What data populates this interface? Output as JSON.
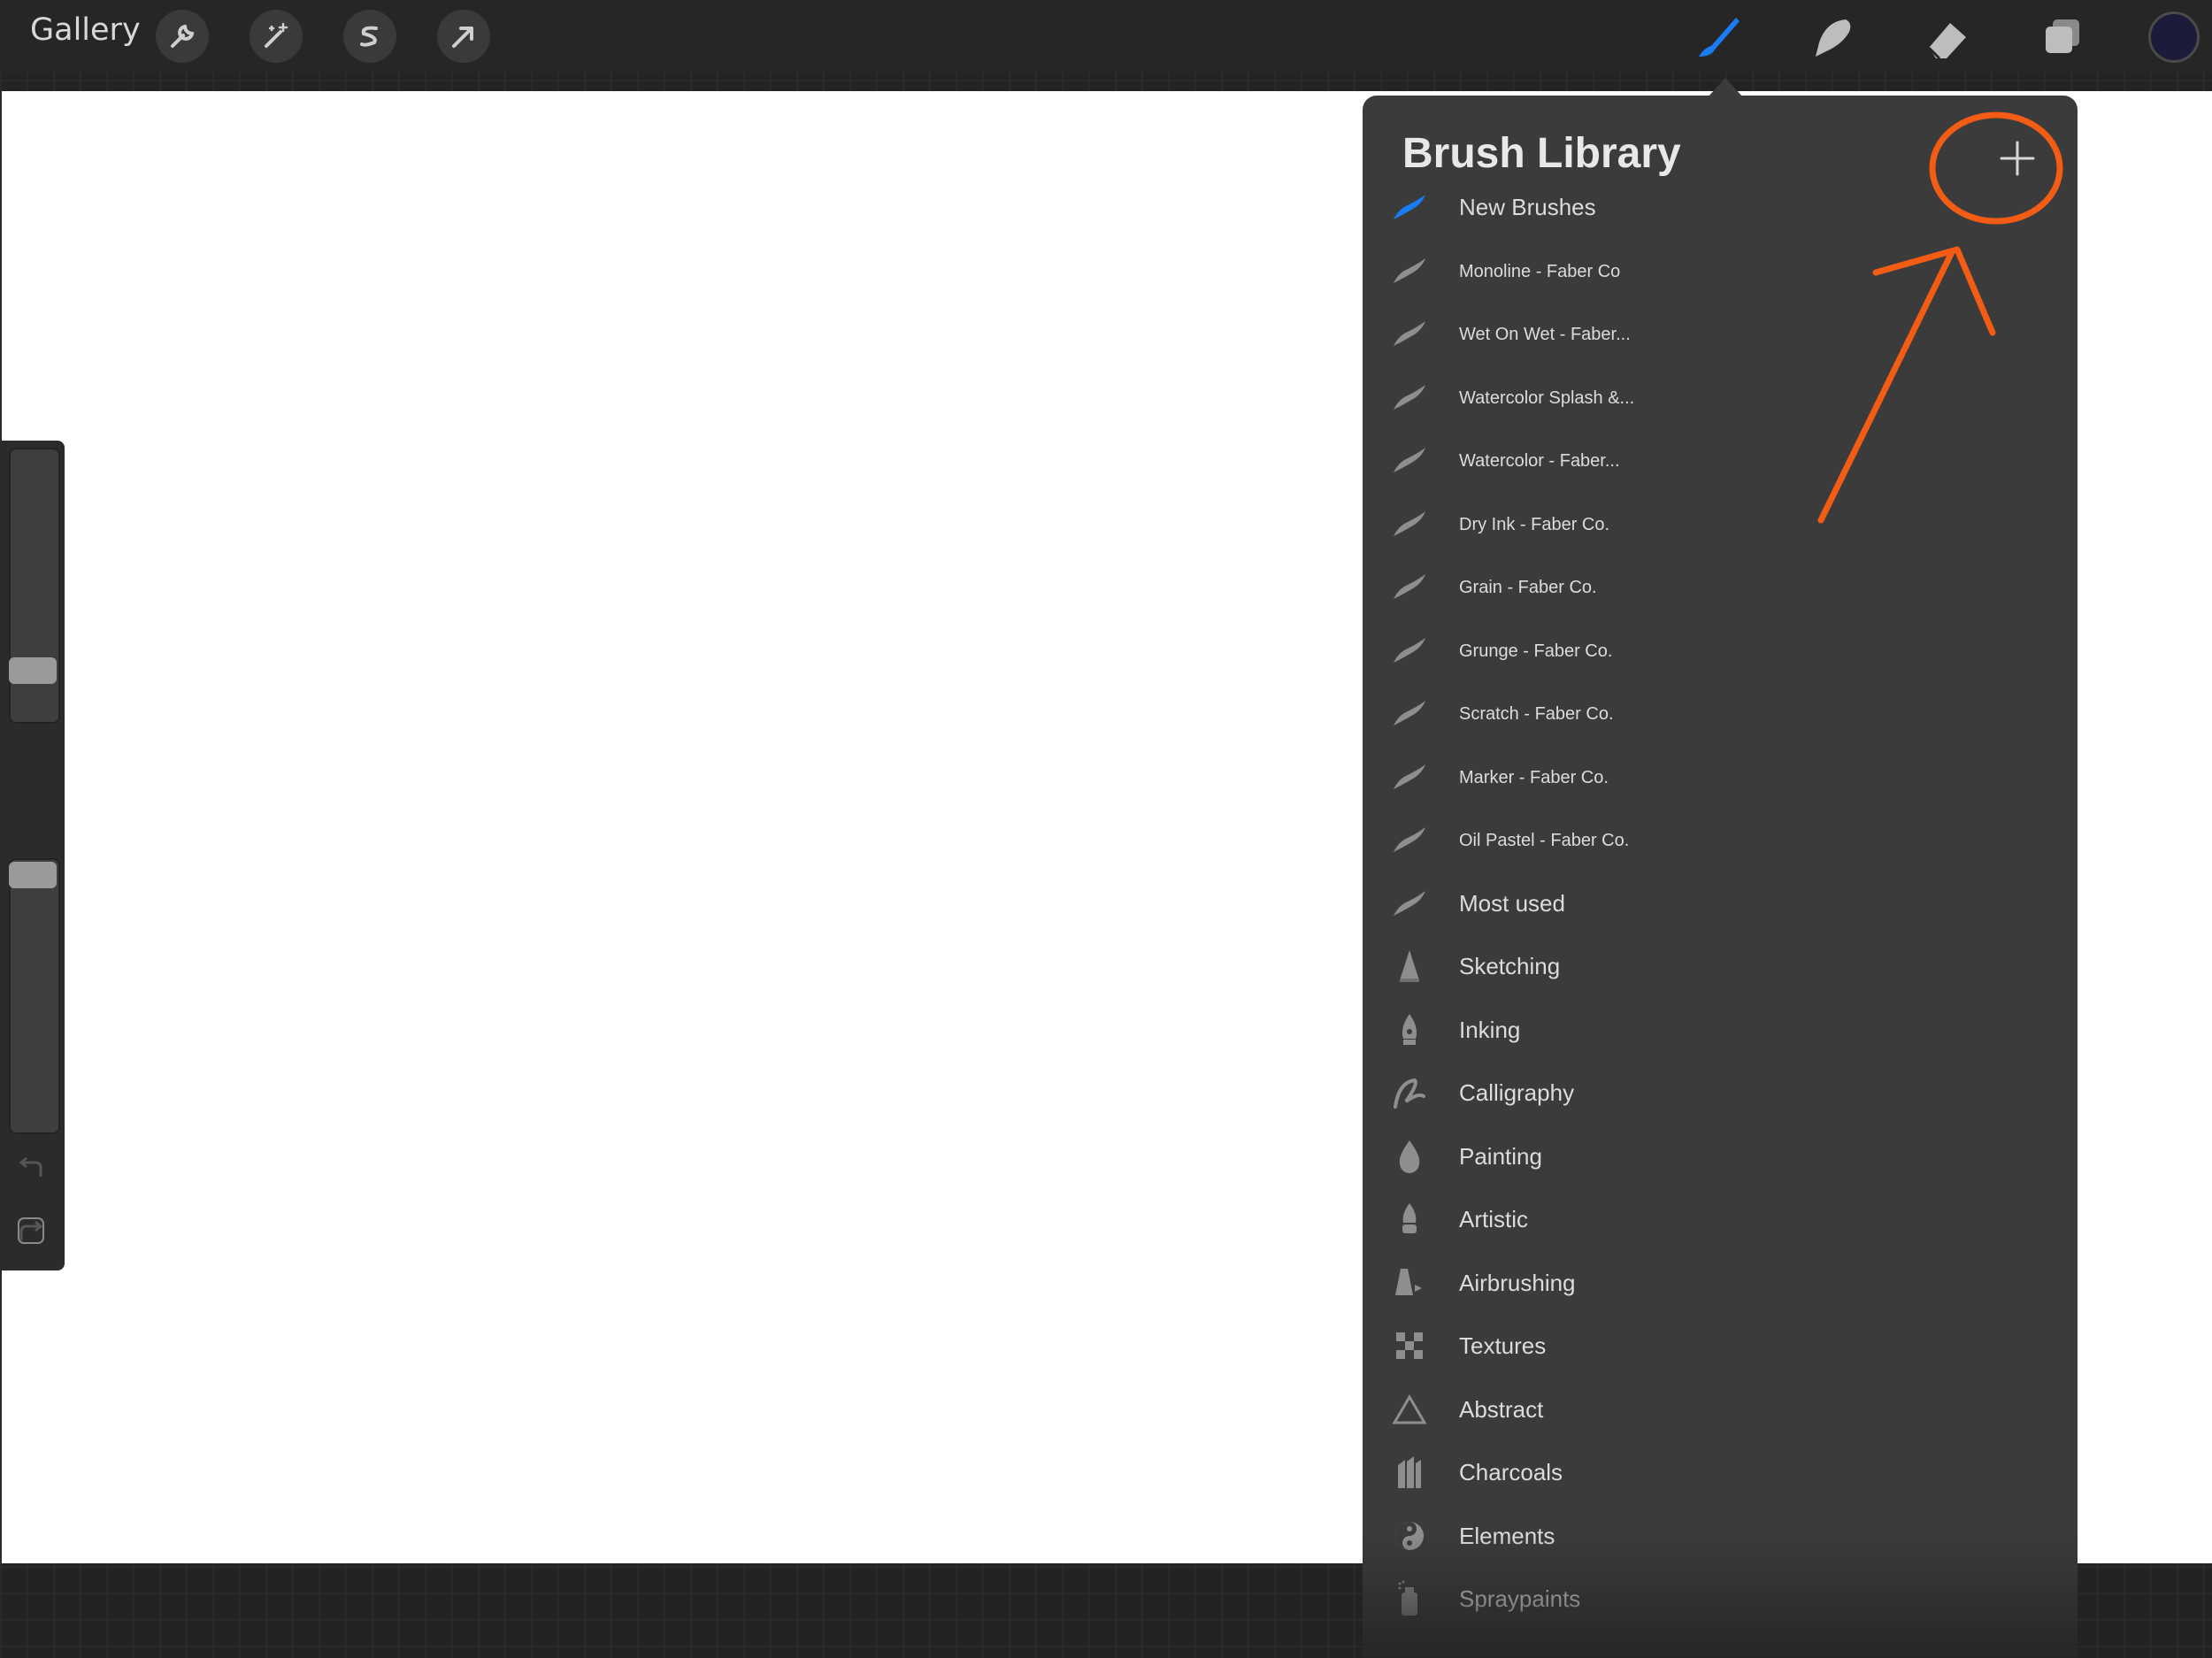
{
  "toolbar": {
    "gallery_label": "Gallery",
    "left_tools": [
      "wrench-icon",
      "magic-wand-icon",
      "selection-icon",
      "transform-arrow-icon"
    ],
    "right_tools": [
      "brush-icon",
      "smudge-icon",
      "eraser-icon",
      "layers-icon"
    ],
    "active_tool": "brush",
    "active_color": "#1d1b3a",
    "accent": "#1a7cf5"
  },
  "brush_library": {
    "title": "Brush Library",
    "add_button": "+",
    "sets": [
      {
        "label": "New Brushes",
        "icon": "brush-stroke-icon",
        "active": true
      },
      {
        "label": "Monoline - Faber Co",
        "icon": "brush-stroke-icon"
      },
      {
        "label": "Wet On Wet - Faber...",
        "icon": "brush-stroke-icon"
      },
      {
        "label": "Watercolor Splash &...",
        "icon": "brush-stroke-icon"
      },
      {
        "label": "Watercolor - Faber...",
        "icon": "brush-stroke-icon"
      },
      {
        "label": "Dry Ink - Faber Co.",
        "icon": "brush-stroke-icon"
      },
      {
        "label": "Grain - Faber Co.",
        "icon": "brush-stroke-icon"
      },
      {
        "label": "Grunge - Faber Co.",
        "icon": "brush-stroke-icon"
      },
      {
        "label": "Scratch - Faber Co.",
        "icon": "brush-stroke-icon"
      },
      {
        "label": "Marker - Faber Co.",
        "icon": "brush-stroke-icon"
      },
      {
        "label": "Oil Pastel - Faber Co.",
        "icon": "brush-stroke-icon"
      },
      {
        "label": "Most used",
        "icon": "brush-stroke-icon"
      },
      {
        "label": "Sketching",
        "icon": "pencil-tip-icon"
      },
      {
        "label": "Inking",
        "icon": "pen-nib-icon"
      },
      {
        "label": "Calligraphy",
        "icon": "calligraphy-icon"
      },
      {
        "label": "Painting",
        "icon": "paint-drop-icon"
      },
      {
        "label": "Artistic",
        "icon": "paint-tube-icon"
      },
      {
        "label": "Airbrushing",
        "icon": "airbrush-icon"
      },
      {
        "label": "Textures",
        "icon": "checker-texture-icon"
      },
      {
        "label": "Abstract",
        "icon": "triangle-icon"
      },
      {
        "label": "Charcoals",
        "icon": "charcoal-icon"
      },
      {
        "label": "Elements",
        "icon": "yin-yang-icon"
      },
      {
        "label": "Spraypaints",
        "icon": "spray-can-icon"
      }
    ]
  },
  "sidebar": {
    "brush_size": 0.18,
    "opacity": 0.98,
    "undo_icon": "undo-icon",
    "redo_icon": "redo-icon"
  },
  "annotation": {
    "color": "#f25c14",
    "shapes": [
      "circle-around-add-button",
      "arrow-pointing-to-add-button"
    ]
  }
}
